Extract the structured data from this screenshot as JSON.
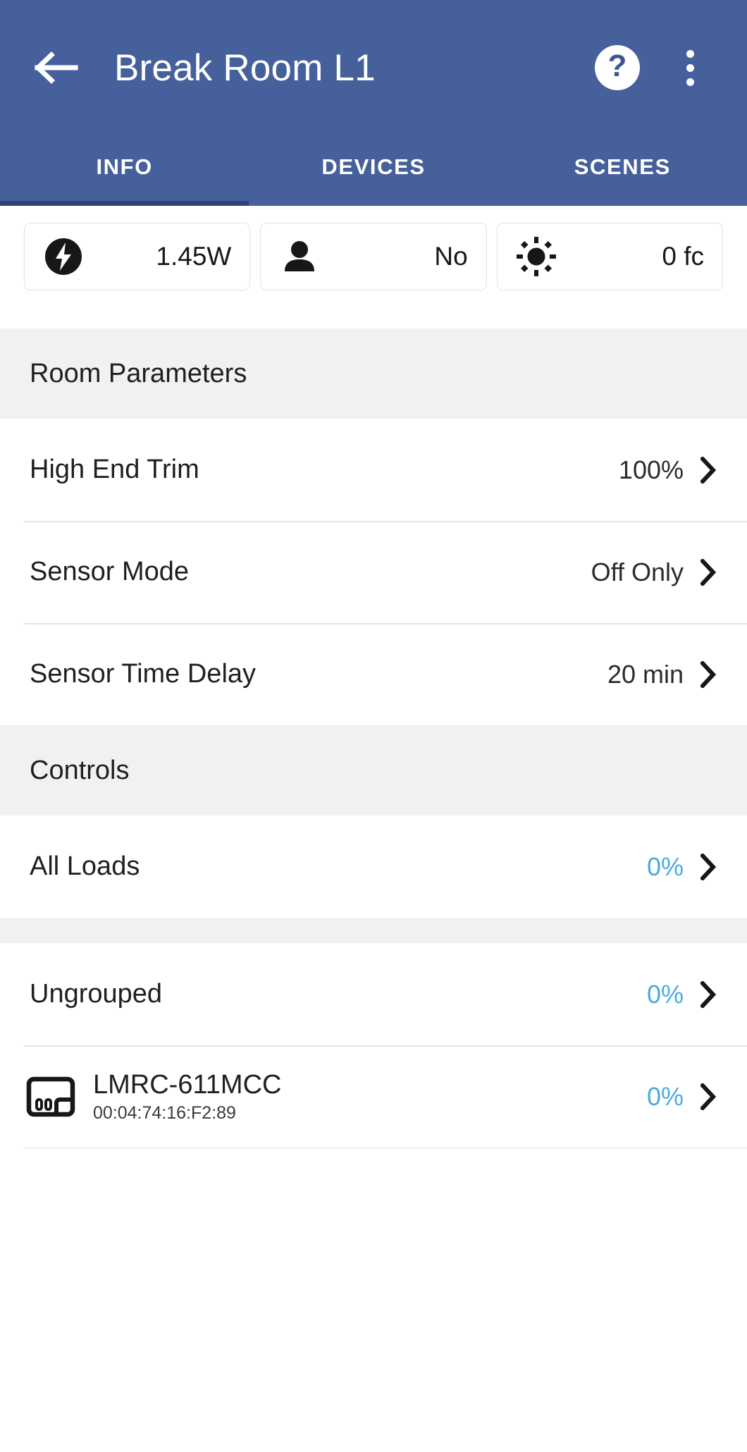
{
  "appbar": {
    "back_icon": "arrow-left-icon",
    "title": "Break Room L1",
    "help_label": "?",
    "help_icon": "help-circle-icon",
    "overflow_icon": "more-vertical-icon",
    "background_color": "#45609B"
  },
  "tabs": [
    {
      "label": "INFO",
      "active": true
    },
    {
      "label": "DEVICES",
      "active": false
    },
    {
      "label": "SCENES",
      "active": false
    }
  ],
  "status_cards": [
    {
      "icon": "power-bolt-icon",
      "value": "1.45W"
    },
    {
      "icon": "person-occupancy-icon",
      "value": "No"
    },
    {
      "icon": "sun-brightness-icon",
      "value": "0 fc"
    }
  ],
  "sections": [
    {
      "header": "Room Parameters",
      "rows": [
        {
          "label": "High End Trim",
          "value": "100%",
          "accent": false,
          "chevron": "chevron-right-icon"
        },
        {
          "label": "Sensor Mode",
          "value": "Off Only",
          "accent": false,
          "chevron": "chevron-right-icon"
        },
        {
          "label": "Sensor Time Delay",
          "value": "20 min",
          "accent": false,
          "chevron": "chevron-right-icon"
        }
      ]
    },
    {
      "header": "Controls",
      "rows": [
        {
          "label": "All Loads",
          "value": "0%",
          "accent": true,
          "chevron": "chevron-right-icon"
        }
      ]
    }
  ],
  "group": {
    "label": "Ungrouped",
    "value": "0%",
    "chevron": "chevron-right-icon"
  },
  "device": {
    "icon": "relay-module-icon",
    "name": "LMRC-611MCC",
    "mac": "00:04:74:16:F2:89",
    "value": "0%",
    "chevron": "chevron-right-icon"
  },
  "colors": {
    "header_blue": "#45609B",
    "tab_indicator": "#2E4373",
    "accent_blue": "#4AABDC",
    "section_bg": "#F1F1F1",
    "text_primary": "#1F1F22"
  }
}
